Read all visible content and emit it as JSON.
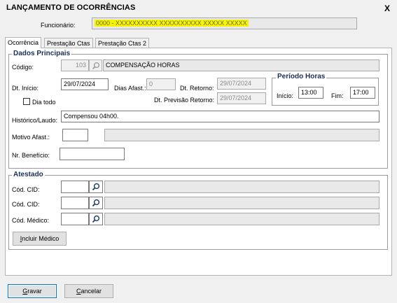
{
  "window": {
    "title": "LANÇAMENTO DE OCORRÊNCIAS",
    "close_glyph": "X"
  },
  "employee": {
    "label": "Funcionário:",
    "value": "0000 - XXXXXXXXXX XXXXXXXXXX XXXXX XXXXX"
  },
  "tabs": [
    {
      "label": "Ocorrência",
      "active": true
    },
    {
      "label": "Prestação Ctas",
      "active": false
    },
    {
      "label": "Prestação Ctas 2",
      "active": false
    }
  ],
  "principal": {
    "group_title": "Dados Principais",
    "codigo_label": "Código:",
    "codigo_value": "103",
    "codigo_desc": "COMPENSAÇÃO HORAS",
    "dt_inicio_label": "Dt. Início:",
    "dt_inicio_value": "29/07/2024",
    "dias_afast_label": "Dias Afast.:",
    "dias_afast_value": "0",
    "dt_retorno_label": "Dt. Retorno:",
    "dt_retorno_value": "29/07/2024",
    "dia_todo_label": "Dia todo",
    "dia_todo_checked": false,
    "dt_prev_retorno_label": "Dt. Previsão Retorno:",
    "dt_prev_retorno_value": "29/07/2024",
    "periodo_title": "Período Horas",
    "inicio_label": "Início:",
    "inicio_value": "13:00",
    "fim_label": "Fim:",
    "fim_value": "17:00",
    "historico_label": "Histórico/Laudo:",
    "historico_value": "Compensou 04h00.",
    "motivo_label": "Motivo Afast.:",
    "motivo_value": "",
    "motivo_desc": "",
    "beneficio_label": "Nr. Benefício:",
    "beneficio_value": ""
  },
  "atestado": {
    "group_title": "Atestado",
    "cid1_label": "Cód. CID:",
    "cid2_label": "Cód. CID:",
    "medico_label": "Cód. Médico:",
    "incluir_medico_label": "Incluir Médico"
  },
  "footer": {
    "save_label": "Gravar",
    "cancel_label": "Cancelar"
  },
  "icons": {
    "search": "search-icon",
    "close": "close-icon"
  },
  "colors": {
    "group_title": "#1b2f55",
    "highlight": "#f7f400",
    "button_focus": "#0078d7"
  }
}
